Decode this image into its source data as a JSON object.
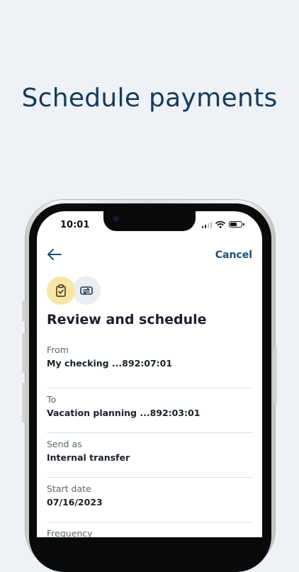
{
  "headline": "Schedule payments",
  "status_bar": {
    "time": "10:01"
  },
  "nav": {
    "back_icon": "arrow-left-icon",
    "cancel_label": "Cancel"
  },
  "steps": [
    {
      "icon": "clipboard-check-icon",
      "active": true
    },
    {
      "icon": "transfer-icon",
      "active": false
    }
  ],
  "title": "Review and schedule",
  "fields": [
    {
      "label": "From",
      "value": "My checking ...892:07:01"
    },
    {
      "label": "To",
      "value": "Vacation planning ...892:03:01"
    },
    {
      "label": "Send as",
      "value": "Internal transfer"
    },
    {
      "label": "Start date",
      "value": "07/16/2023"
    },
    {
      "label": "Frequency",
      "value": ""
    }
  ],
  "colors": {
    "background": "#eef2f6",
    "headline": "#143b5b",
    "accent": "#1a4d78",
    "step_active": "#f7e6a6",
    "step_inactive": "#e9eef3"
  }
}
